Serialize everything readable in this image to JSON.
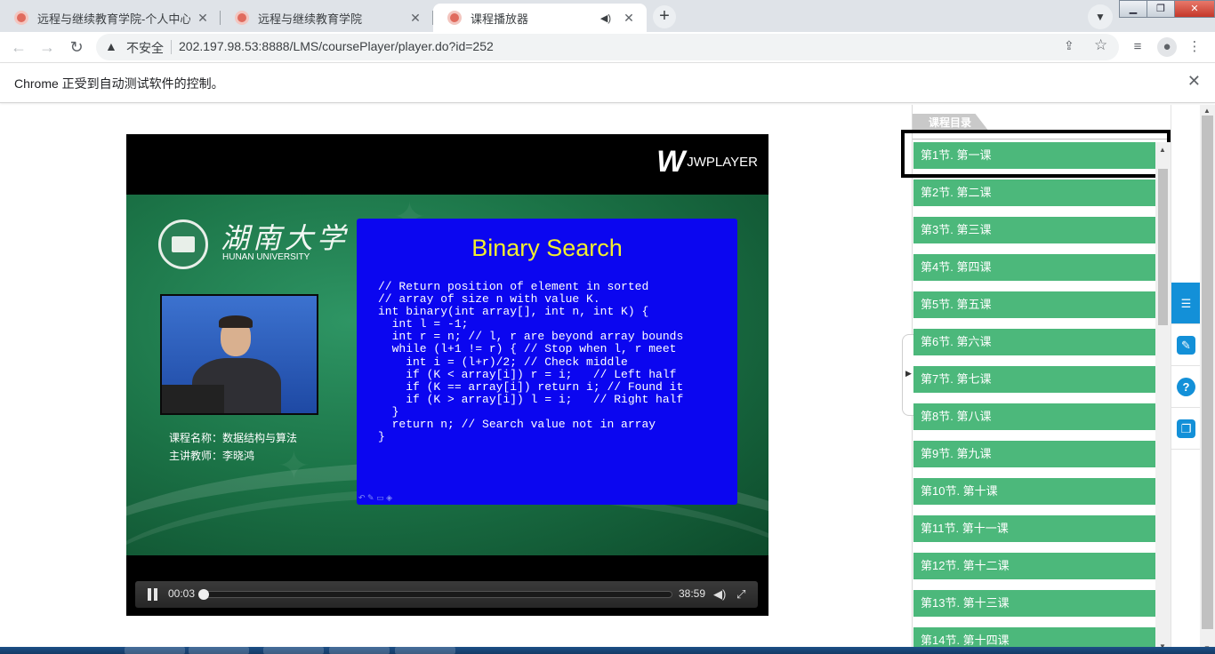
{
  "browser": {
    "tabs": [
      {
        "title": "远程与继续教育学院-个人中心",
        "active": false
      },
      {
        "title": "远程与继续教育学院",
        "active": false
      },
      {
        "title": "课程播放器",
        "active": true
      }
    ],
    "new_tab_label": "+",
    "close_glyph": "✕",
    "address": {
      "security_label": "不安全",
      "url": "202.197.98.53:8888/LMS/coursePlayer/player.do?id=252"
    },
    "infobar_message": "Chrome 正受到自动测试软件的控制。"
  },
  "player": {
    "brand": "JWPLAYER",
    "video": {
      "university_cn": "湖南大学",
      "university_en": "HUNAN UNIVERSITY",
      "course_name_line": "课程名称：数据结构与算法",
      "lecturer_line": "主讲教师：李晓鸿",
      "slide_title": "Binary Search",
      "slide_code": [
        "// Return position of element in sorted",
        "// array of size n with value K.",
        "int binary(int array[], int n, int K) {",
        "  int l = -1;",
        "  int r = n; // l, r are beyond array bounds",
        "  while (l+1 != r) { // Stop when l, r meet",
        "    int i = (l+r)/2; // Check middle",
        "    if (K < array[i]) r = i;   // Left half",
        "    if (K == array[i]) return i; // Found it",
        "    if (K > array[i]) l = i;   // Right half",
        "  }",
        "  return n; // Search value not in array",
        "}"
      ]
    },
    "controls": {
      "state": "playing",
      "elapsed": "00:03",
      "duration": "38:59",
      "progress_fraction": 0.0013
    }
  },
  "sidebar": {
    "tab_label": "课程目录",
    "selected_index": 0,
    "lessons": [
      "第1节. 第一课",
      "第2节. 第二课",
      "第3节. 第三课",
      "第4节. 第四课",
      "第5节. 第五课",
      "第6节. 第六课",
      "第7节. 第七课",
      "第8节. 第八课",
      "第9节. 第九课",
      "第10节. 第十课",
      "第11节. 第十一课",
      "第12节. 第十二课",
      "第13节. 第十三课",
      "第14节. 第十四课"
    ]
  },
  "toolstrip": [
    {
      "icon": "list-icon",
      "active": true
    },
    {
      "icon": "pencil-icon",
      "active": false
    },
    {
      "icon": "help-icon",
      "active": false
    },
    {
      "icon": "window-icon",
      "active": false
    }
  ],
  "colors": {
    "lesson_green": "#4cb87b",
    "accent_blue": "#1390d8",
    "slide_blue": "#0b06f0",
    "slide_title_yellow": "#f2ee2e"
  }
}
